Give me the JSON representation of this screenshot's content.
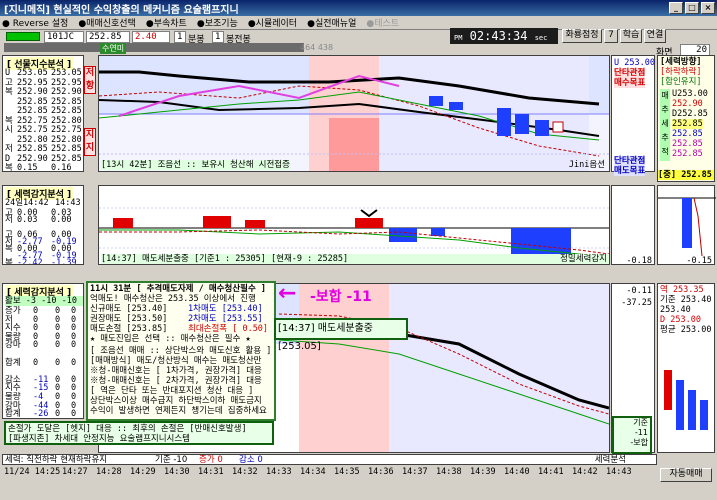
{
  "window": {
    "title": "[지니메직] 현실적인 수익창출의 메커니즘 요술램프지니"
  },
  "menu": [
    {
      "label": "● Reverse 설정",
      "enabled": true
    },
    {
      "label": "●매매신호선택",
      "enabled": true
    },
    {
      "label": "●부속차트",
      "enabled": true
    },
    {
      "label": "●보조기능",
      "enabled": true
    },
    {
      "label": "●시뮬레이터",
      "enabled": true
    },
    {
      "label": "●실전매뉴얼",
      "enabled": true
    },
    {
      "label": "●테스트",
      "enabled": false
    }
  ],
  "toolbar": {
    "code": "101JC",
    "price": "252.85",
    "change": "2.40",
    "period": "1",
    "period_unit": "분봉",
    "count": "1",
    "count_unit": "봉전봉",
    "sub_label_1": "수연미",
    "sub_value": "464 438",
    "clock": "02:43:34",
    "clock_prefix": "PM",
    "clock_suffix": "sec",
    "btn_zero": "화룡점정",
    "btn_seven": "7",
    "btn_study": "학습",
    "btn_link": "연결",
    "screen_label": "화면",
    "screen_value": "20"
  },
  "futures_panel": {
    "title": "[ 선물지수분석 ]",
    "rows": [
      [
        "U",
        "253.05",
        "253.05"
      ],
      [
        "고",
        "252.95",
        "252.95"
      ],
      [
        "복",
        "252.90",
        "252.90"
      ],
      [
        "",
        "252.85",
        "252.85"
      ],
      [
        "",
        "252.85",
        "252.85"
      ],
      [
        "복",
        "252.75",
        "252.80"
      ],
      [
        "시",
        "252.75",
        "252.75"
      ],
      [
        "",
        "252.80",
        "252.80"
      ],
      [
        "저",
        "252.85",
        "252.85"
      ],
      [
        "D",
        "252.90",
        "252.85"
      ],
      [
        "복",
        "0.15",
        "0.16"
      ]
    ],
    "side_labels": [
      "저",
      "항"
    ],
    "side_labels_2": [
      "지",
      "지"
    ]
  },
  "trend_box": {
    "title": "[세력방향]",
    "tag1": "[하락하락]",
    "tag2": "[합인유지]",
    "u": "U253.00",
    "v1": "252.90",
    "v2": "D252.85",
    "v3": "252.85",
    "v4": "252.85",
    "v5": "252.85",
    "v6": "252.85",
    "side": [
      "매",
      "추",
      "세",
      "추",
      "적"
    ],
    "bottom": "252.85",
    "bottom_tag": "[중]"
  },
  "chart1": {
    "top_right": "U 253.00",
    "note1": "단타관점",
    "note2": "매수목표",
    "note3": "단타관점",
    "note4": "매도목표",
    "note5": "D 252.90",
    "status": "[13시 42분] 조음선 :: 보유시 청산해 시전접증",
    "footer_right": "Jini옵션",
    "x_labels": []
  },
  "force_panel": {
    "title": "[ 세력감지분석 ]",
    "date": "24일14:42",
    "time": "14:43",
    "rows": [
      [
        "고",
        "0.00",
        "0.03"
      ],
      [
        "저",
        "0.03",
        "0.00"
      ],
      [
        "",
        "",
        ""
      ],
      [
        "고",
        "0.06",
        "0.00"
      ],
      [
        "저",
        "-2.77",
        "-0.19"
      ],
      [
        "복",
        "0.00",
        "0.00"
      ],
      [
        "",
        "-2.77",
        "-0.19"
      ],
      [
        "복",
        "-2.42",
        "-1.39"
      ]
    ]
  },
  "chart2": {
    "status": "[14:37] 매도세분출중 [기준1 : 25305] [현재-9 : 25285]",
    "right_label": "정밀세력감지",
    "value_right": "-0.18",
    "side_value": "-0.15",
    "side_value2": "-0.18"
  },
  "signal_panel": {
    "title": "[ 세력감지분석 ]",
    "header": [
      "활보",
      "-3",
      "-10",
      "-10"
    ],
    "rows": [
      [
        "증가",
        "0",
        "0",
        "0"
      ],
      [
        "저",
        "0",
        "0",
        "0"
      ],
      [
        "지수",
        "0",
        "0",
        "0"
      ],
      [
        "물량",
        "0",
        "0",
        "0"
      ],
      [
        "강마",
        "0",
        "0",
        "0"
      ],
      [
        "",
        "",
        " ",
        ""
      ],
      [
        "합계",
        "0",
        "0",
        "0"
      ],
      [
        "",
        "",
        " ",
        ""
      ],
      [
        "감소",
        "-11",
        "0",
        "0"
      ],
      [
        "지수",
        "-15",
        "0",
        "0"
      ],
      [
        "물량",
        "-4",
        "0",
        "0"
      ],
      [
        "강마",
        "-44",
        "0",
        "0"
      ],
      [
        "합계",
        "-26",
        "0",
        "0"
      ]
    ]
  },
  "info_box": {
    "line1": "11시 31분 [ 추격매도자제 / 매수청산필수 ]",
    "line2": "억매도! 매수청산은 253.35 이상에서 진행",
    "l3a": "신규매도 [253.40]",
    "l3b": "1차매도 [253.40]",
    "l4a": "권장매도 [253.50]",
    "l4b": "2차매도 [253.55]",
    "l5a": "매도손절 [253.85]",
    "l5b": "최대손절폭 [ 0.50]",
    "l6": "★ 매도진입은 선택 :: 매수청산은 필수 ★",
    "l7": "[ 조음선 매매 :: 상단박스와 매도신호 활용 ]",
    "l8": "[매매방식] 매도/청산방식 매수는 매도청산만",
    "l9": "※청-매매신호는 [ 1차가격, 권장가격] 대응",
    "l10": "※청-매매신호는 [ 2차가격, 권장가격] 대응",
    "l11": "[ 역은 단타 또는 반대포지션 청산 대응 ]",
    "l12": "상단박스이상 매수급지  하단박스이하 매도금지",
    "l13": "수익이 발생하면 연제든지 챙기는데 집중하세요",
    "l14": "손절가 도달은 [헷지] 대응 :: 최후의 손절은 [반매신호발생]",
    "l15": "[파생지존] 차세대 안정지능 요술램프지니시스템"
  },
  "annotation": {
    "arrow": "←",
    "text": "-보합 -11",
    "green_box": "[14:37] 매도세분출중[253.05]"
  },
  "right_mini": {
    "s1": "역 253.35",
    "s2": "기준 253.40",
    "s3": "253.40",
    "s4": "D 253.00",
    "s5": "평균 253.00",
    "val_top": "-0.11",
    "val2": "-37.25",
    "bottom_label": "기준",
    "bottom_v1": "-11",
    "bottom_v2": "-보합",
    "footer": "세력분석"
  },
  "status_line": {
    "left": "세력: 직전하락 현재하락유지",
    "mid1": "기준 -10",
    "mid2": "증가 0",
    "mid3": "감소 0",
    "right": "세력분석"
  },
  "time_axis": [
    "11/24 14:25",
    "14:27",
    "14:28",
    "14:29",
    "14:30",
    "14:31",
    "14:32",
    "14:33",
    "14:34",
    "14:35",
    "14:36",
    "14:37",
    "14:38",
    "14:39",
    "14:40",
    "14:41",
    "14:42",
    "14:43"
  ],
  "auto_trade_button": "자동매매"
}
